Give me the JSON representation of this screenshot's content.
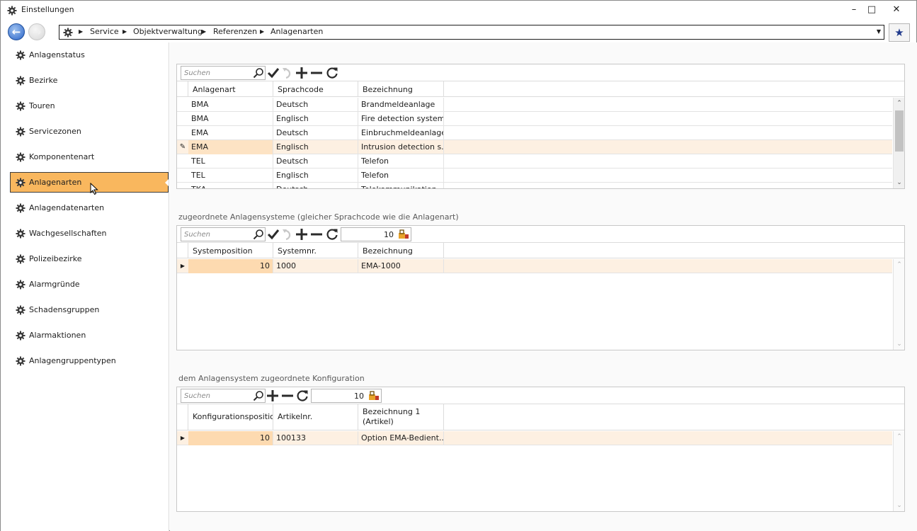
{
  "window": {
    "title": "Einstellungen",
    "minimize": "–",
    "maximize": "□",
    "close": "✕"
  },
  "nav": {
    "breadcrumbs": [
      "Service",
      "Objektverwaltung",
      "Referenzen",
      "Anlagenarten"
    ],
    "favorite_icon": "star-icon"
  },
  "sidebar": {
    "items": [
      {
        "label": "Anlagenstatus",
        "active": false
      },
      {
        "label": "Bezirke",
        "active": false
      },
      {
        "label": "Touren",
        "active": false
      },
      {
        "label": "Servicezonen",
        "active": false
      },
      {
        "label": "Komponentenart",
        "active": false
      },
      {
        "label": "Anlagenarten",
        "active": true
      },
      {
        "label": "Anlagendatenarten",
        "active": false
      },
      {
        "label": "Wachgesellschaften",
        "active": false
      },
      {
        "label": "Polizeibezirke",
        "active": false
      },
      {
        "label": "Alarmgründe",
        "active": false
      },
      {
        "label": "Schadensgruppen",
        "active": false
      },
      {
        "label": "Alarmaktionen",
        "active": false
      },
      {
        "label": "Anlagengruppentypen",
        "active": false
      }
    ]
  },
  "grid1": {
    "search_placeholder": "Suchen",
    "columns": [
      "Anlagenart",
      "Sprachcode",
      "Bezeichnung"
    ],
    "rows": [
      {
        "c1": "BMA",
        "c2": "Deutsch",
        "c3": "Brandmeldeanlage"
      },
      {
        "c1": "BMA",
        "c2": "Englisch",
        "c3": "Fire detection system"
      },
      {
        "c1": "EMA",
        "c2": "Deutsch",
        "c3": "Einbruchmeldeanlage"
      },
      {
        "c1": "EMA",
        "c2": "Englisch",
        "c3": "Intrusion detection s..."
      },
      {
        "c1": "TEL",
        "c2": "Deutsch",
        "c3": "Telefon"
      },
      {
        "c1": "TEL",
        "c2": "Englisch",
        "c3": "Telefon"
      },
      {
        "c1": "TKA",
        "c2": "Deutsch",
        "c3": "Telekommunikation"
      }
    ]
  },
  "grid2": {
    "title": "zugeordnete Anlagensysteme (gleicher Sprachcode wie die Anlagenart)",
    "search_placeholder": "Suchen",
    "count": "10",
    "columns": [
      "Systemposition",
      "Systemnr.",
      "Bezeichnung"
    ],
    "rows": [
      {
        "c1": "10",
        "c2": "1000",
        "c3": "EMA-1000"
      }
    ]
  },
  "grid3": {
    "title": "dem Anlagensystem zugeordnete Konfiguration",
    "search_placeholder": "Suchen",
    "count": "10",
    "columns": [
      "Konfigurationsposition",
      "Artikelnr.",
      "Bezeichnung 1 (Artikel)"
    ],
    "rows": [
      {
        "c1": "10",
        "c2": "100133",
        "c3": "Option EMA-Bedient..."
      }
    ]
  }
}
